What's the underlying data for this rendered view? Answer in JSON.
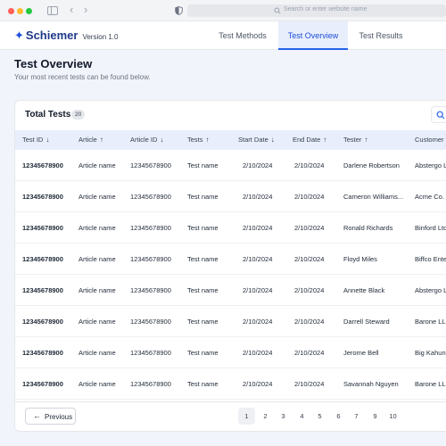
{
  "browser": {
    "url_placeholder": "Search or enter website name"
  },
  "app": {
    "brand_name": "Schiemer",
    "version": "Version 1.0",
    "tabs": [
      {
        "label": "Test Methods"
      },
      {
        "label": "Test Overview",
        "active": true
      },
      {
        "label": "Test Results"
      }
    ]
  },
  "page": {
    "title": "Test Overview",
    "subtitle": "Your most recent tests can be found below."
  },
  "table": {
    "title": "Total Tests",
    "count": "20",
    "columns": [
      {
        "label": "Test ID",
        "sort": "down"
      },
      {
        "label": "Article",
        "sort": "up"
      },
      {
        "label": "Article ID",
        "sort": "down"
      },
      {
        "label": "Tests",
        "sort": "up"
      },
      {
        "label": "Start Date",
        "sort": "down"
      },
      {
        "label": "End Date",
        "sort": "up"
      },
      {
        "label": "Tester",
        "sort": "up"
      },
      {
        "label": "Customer",
        "sort": ""
      }
    ],
    "rows": [
      {
        "test_id": "12345678900",
        "article": "Article name",
        "article_id": "12345678900",
        "tests": "Test name",
        "start": "2/10/2024",
        "end": "2/10/2024",
        "tester": "Darlene Robertson",
        "customer": "Abstergo L"
      },
      {
        "test_id": "12345678900",
        "article": "Article name",
        "article_id": "12345678900",
        "tests": "Test name",
        "start": "2/10/2024",
        "end": "2/10/2024",
        "tester": "Cameron Williams...",
        "customer": "Acme Co."
      },
      {
        "test_id": "12345678900",
        "article": "Article name",
        "article_id": "12345678900",
        "tests": "Test name",
        "start": "2/10/2024",
        "end": "2/10/2024",
        "tester": "Ronald Richards",
        "customer": "Binford Ltd"
      },
      {
        "test_id": "12345678900",
        "article": "Article name",
        "article_id": "12345678900",
        "tests": "Test name",
        "start": "2/10/2024",
        "end": "2/10/2024",
        "tester": "Floyd Miles",
        "customer": "Biffco Ente"
      },
      {
        "test_id": "12345678900",
        "article": "Article name",
        "article_id": "12345678900",
        "tests": "Test name",
        "start": "2/10/2024",
        "end": "2/10/2024",
        "tester": "Annette Black",
        "customer": "Abstergo L"
      },
      {
        "test_id": "12345678900",
        "article": "Article name",
        "article_id": "12345678900",
        "tests": "Test name",
        "start": "2/10/2024",
        "end": "2/10/2024",
        "tester": "Darrell Steward",
        "customer": "Barone LLC"
      },
      {
        "test_id": "12345678900",
        "article": "Article name",
        "article_id": "12345678900",
        "tests": "Test name",
        "start": "2/10/2024",
        "end": "2/10/2024",
        "tester": "Jerome Bell",
        "customer": "Big Kahuna"
      },
      {
        "test_id": "12345678900",
        "article": "Article name",
        "article_id": "12345678900",
        "tests": "Test name",
        "start": "2/10/2024",
        "end": "2/10/2024",
        "tester": "Savannah Nguyen",
        "customer": "Barone LLC"
      }
    ]
  },
  "pagination": {
    "previous_label": "Previous",
    "pages": [
      "1",
      "2",
      "3",
      "4",
      "5",
      "6",
      "7",
      "9",
      "10"
    ],
    "current_page": "1"
  },
  "colors": {
    "accent": "#2563eb",
    "brand": "#1e3a8a",
    "active_tab_bg": "#e8eefc",
    "table_header_bg": "#e8eefc"
  }
}
